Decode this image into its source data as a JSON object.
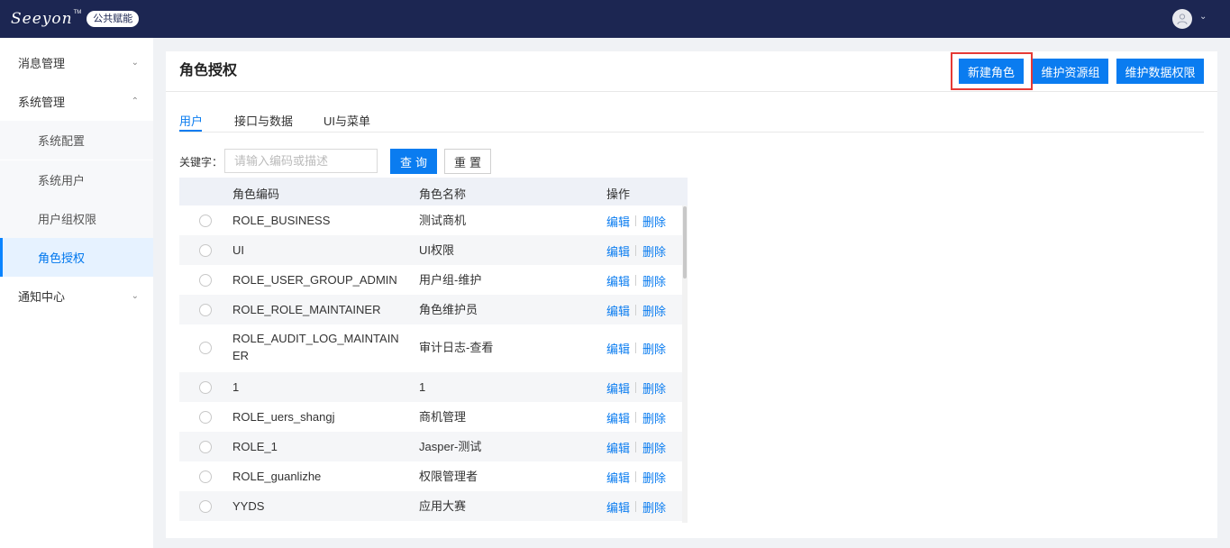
{
  "topbar": {
    "logo_text": "Seeyon",
    "logo_tm": "TM",
    "logo_badge": "公共赋能",
    "avatar_icon": "user-icon",
    "caret_icon": "chevron-down-icon"
  },
  "sidebar": {
    "items": [
      {
        "label": "消息管理",
        "chevron": "chevron-down-icon"
      },
      {
        "label": "系统管理",
        "chevron": "chevron-up-icon"
      },
      {
        "label": "通知中心",
        "chevron": "chevron-down-icon"
      }
    ],
    "subitems": [
      {
        "label": "系统配置"
      },
      {
        "label": "系统用户"
      },
      {
        "label": "用户组权限"
      },
      {
        "label": "角色授权",
        "active": true
      }
    ]
  },
  "page": {
    "title": "角色授权",
    "buttons": {
      "new_role": "新建角色",
      "maintain_resource_group": "维护资源组",
      "maintain_data_permission": "维护数据权限"
    }
  },
  "tabs": [
    {
      "label": "用户",
      "active": true
    },
    {
      "label": "接口与数据"
    },
    {
      "label": "UI与菜单"
    }
  ],
  "search": {
    "label": "关键字：",
    "placeholder": "请输入编码或描述",
    "value": "",
    "query_label": "查询",
    "reset_label": "重置"
  },
  "table": {
    "headers": {
      "code": "角色编码",
      "name": "角色名称",
      "actions": "操作"
    },
    "edit_label": "编辑",
    "delete_label": "删除",
    "rows": [
      {
        "code": "ROLE_BUSINESS",
        "name": "测试商机"
      },
      {
        "code": "UI",
        "name": "UI权限"
      },
      {
        "code": "ROLE_USER_GROUP_ADMIN",
        "name": "用户组-维护"
      },
      {
        "code": "ROLE_ROLE_MAINTAINER",
        "name": "角色维护员"
      },
      {
        "code": "ROLE_AUDIT_LOG_MAINTAINER",
        "name": "审计日志-查看"
      },
      {
        "code": "1",
        "name": "1"
      },
      {
        "code": "ROLE_uers_shangj",
        "name": "商机管理"
      },
      {
        "code": "ROLE_1",
        "name": "Jasper-测试"
      },
      {
        "code": "ROLE_guanlizhe",
        "name": "权限管理者"
      },
      {
        "code": "YYDS",
        "name": "应用大赛"
      }
    ]
  },
  "colors": {
    "topbar": "#1c2652",
    "primary": "#0a7cf0",
    "highlight": "#e53935"
  }
}
